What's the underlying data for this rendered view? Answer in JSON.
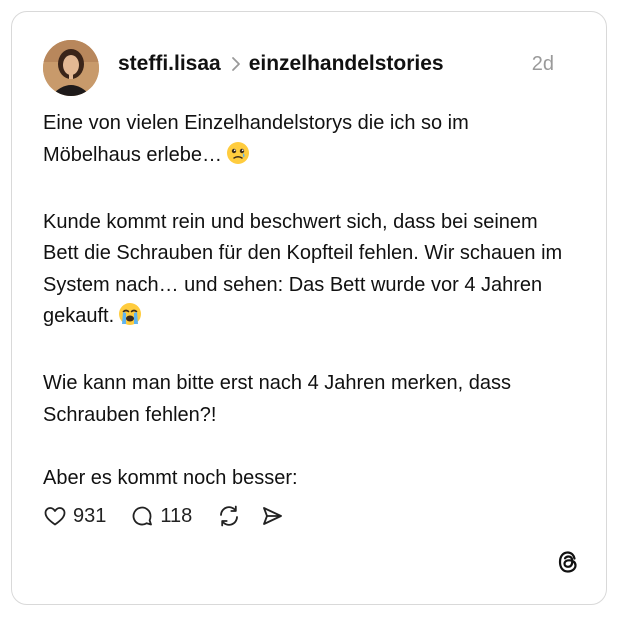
{
  "post": {
    "username": "steffi.lisaa",
    "community": "einzelhandelstories",
    "time": "2d",
    "paragraphs": [
      "Eine von vielen  Einzelhandelstorys die ich so im Möbelhaus erlebe…",
      "Kunde kommt rein und beschwert sich, dass bei seinem Bett die Schrauben für den Kopfteil fehlen. Wir schauen im System nach… und sehen: Das Bett wurde vor 4 Jahren gekauft.",
      "Wie kann man bitte erst nach 4 Jahren merken, dass Schrauben fehlen?!",
      "Aber es kommt noch besser:"
    ],
    "emoji_1": "face-holding-back-tears-icon",
    "emoji_2": "loudly-crying-face-icon"
  },
  "actions": {
    "likes": "931",
    "comments": "118",
    "like_icon": "heart-icon",
    "comment_icon": "speech-bubble-icon",
    "repost_icon": "repost-icon",
    "share_icon": "send-icon"
  },
  "branding": {
    "logo": "threads-logo-icon"
  },
  "colors": {
    "border": "#d9d9d9",
    "muted": "#9a9a9a",
    "text": "#111111"
  }
}
